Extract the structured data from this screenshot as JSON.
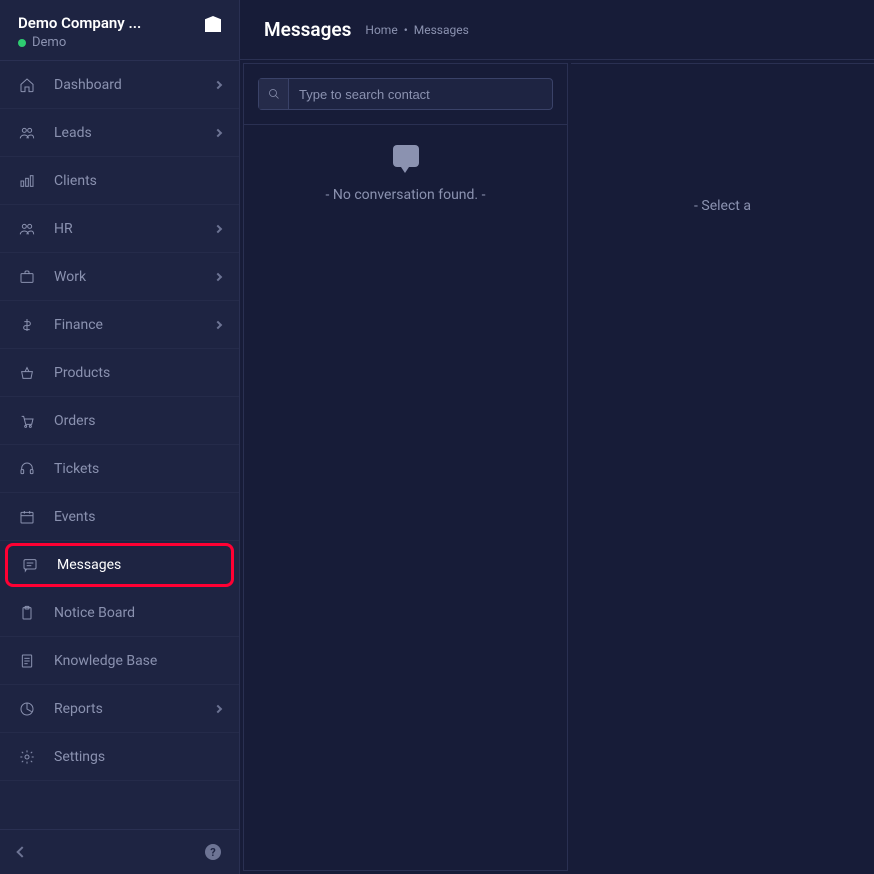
{
  "header": {
    "company_name": "Demo Company ...",
    "status_text": "Demo"
  },
  "nav": [
    {
      "label": "Dashboard",
      "icon": "home-icon",
      "chevron": true,
      "highlight": false
    },
    {
      "label": "Leads",
      "icon": "people-icon",
      "chevron": true,
      "highlight": false
    },
    {
      "label": "Clients",
      "icon": "bars-icon",
      "chevron": false,
      "highlight": false
    },
    {
      "label": "HR",
      "icon": "people-icon",
      "chevron": true,
      "highlight": false
    },
    {
      "label": "Work",
      "icon": "briefcase-icon",
      "chevron": true,
      "highlight": false
    },
    {
      "label": "Finance",
      "icon": "dollar-icon",
      "chevron": true,
      "highlight": false
    },
    {
      "label": "Products",
      "icon": "basket-icon",
      "chevron": false,
      "highlight": false
    },
    {
      "label": "Orders",
      "icon": "cart-icon",
      "chevron": false,
      "highlight": false
    },
    {
      "label": "Tickets",
      "icon": "headset-icon",
      "chevron": false,
      "highlight": false
    },
    {
      "label": "Events",
      "icon": "calendar-icon",
      "chevron": false,
      "highlight": false
    },
    {
      "label": "Messages",
      "icon": "message-icon",
      "chevron": false,
      "highlight": true
    },
    {
      "label": "Notice Board",
      "icon": "clipboard-icon",
      "chevron": false,
      "highlight": false
    },
    {
      "label": "Knowledge Base",
      "icon": "document-icon",
      "chevron": false,
      "highlight": false
    },
    {
      "label": "Reports",
      "icon": "pie-icon",
      "chevron": true,
      "highlight": false
    },
    {
      "label": "Settings",
      "icon": "gear-icon",
      "chevron": false,
      "highlight": false
    }
  ],
  "page": {
    "title": "Messages",
    "breadcrumb": [
      "Home",
      "Messages"
    ]
  },
  "search": {
    "placeholder": "Type to search contact"
  },
  "contact_empty": "- No conversation found. -",
  "message_empty": "- Select a"
}
